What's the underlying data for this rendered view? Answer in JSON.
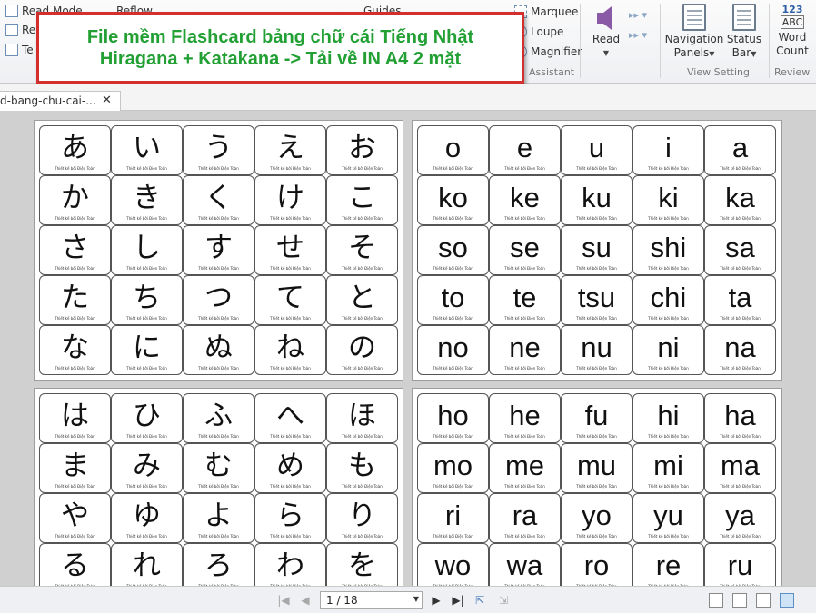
{
  "ribbon": {
    "left_items": [
      {
        "label": "Read Mode",
        "icon": "read-mode-icon"
      },
      {
        "label": "Re",
        "icon": "reflow-small-icon"
      },
      {
        "label": "Te",
        "icon": "text-icon"
      }
    ],
    "reflow_label": "Reflow",
    "guides_label": "Guides",
    "assistant": {
      "items": [
        {
          "label": "Marquee",
          "icon": "marquee-icon"
        },
        {
          "label": "Loupe",
          "icon": "loupe-icon"
        },
        {
          "label": "Magnifier",
          "icon": "magnifier-icon"
        }
      ],
      "group_label": "Assistant"
    },
    "read_button": {
      "label": "Read",
      "icon": "speaker-icon"
    },
    "view_setting": {
      "navigation_panels": {
        "line1": "Navigation",
        "line2": "Panels"
      },
      "status_bar": {
        "line1": "Status",
        "line2": "Bar"
      },
      "group_label": "View Setting"
    },
    "review": {
      "word_count": {
        "line1": "Word",
        "line2": "Count",
        "icon_text_top": "123",
        "icon_text_bottom": "ABC"
      },
      "group_label": "Review"
    }
  },
  "banner": {
    "line1": "File mềm Flashcard bảng chữ cái Tiếng Nhật",
    "line2": "Hiragana + Katakana -> Tải về IN A4 2 mặt"
  },
  "document_tab": {
    "label": "d-bang-chu-cai-...",
    "close": "✕"
  },
  "card_credit": "Thiết kế bởi Điện Toàn",
  "pages": [
    {
      "rows": [
        [
          "あ",
          "い",
          "う",
          "え",
          "お"
        ],
        [
          "か",
          "き",
          "く",
          "け",
          "こ"
        ],
        [
          "さ",
          "し",
          "す",
          "せ",
          "そ"
        ],
        [
          "た",
          "ち",
          "つ",
          "て",
          "と"
        ],
        [
          "な",
          "に",
          "ぬ",
          "ね",
          "の"
        ]
      ]
    },
    {
      "rows": [
        [
          "o",
          "e",
          "u",
          "i",
          "a"
        ],
        [
          "ko",
          "ke",
          "ku",
          "ki",
          "ka"
        ],
        [
          "so",
          "se",
          "su",
          "shi",
          "sa"
        ],
        [
          "to",
          "te",
          "tsu",
          "chi",
          "ta"
        ],
        [
          "no",
          "ne",
          "nu",
          "ni",
          "na"
        ]
      ]
    },
    {
      "rows": [
        [
          "は",
          "ひ",
          "ふ",
          "へ",
          "ほ"
        ],
        [
          "ま",
          "み",
          "む",
          "め",
          "も"
        ],
        [
          "や",
          "ゆ",
          "よ",
          "ら",
          "り"
        ],
        [
          "る",
          "れ",
          "ろ",
          "わ",
          "を"
        ]
      ]
    },
    {
      "rows": [
        [
          "ho",
          "he",
          "fu",
          "hi",
          "ha"
        ],
        [
          "mo",
          "me",
          "mu",
          "mi",
          "ma"
        ],
        [
          "ri",
          "ra",
          "yo",
          "yu",
          "ya"
        ],
        [
          "wo",
          "wa",
          "ro",
          "re",
          "ru"
        ]
      ]
    }
  ],
  "status_bar": {
    "page_display": "1 / 18",
    "first_icon": "first-page-icon",
    "prev_icon": "previous-page-icon",
    "next_icon": "next-page-icon",
    "last_icon": "last-page-icon"
  }
}
